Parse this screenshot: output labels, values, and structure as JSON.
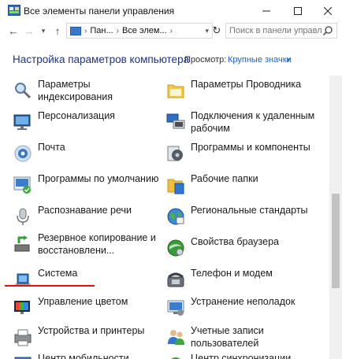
{
  "window": {
    "title": "Все элементы панели управления",
    "controls": [
      "minimize",
      "maximize",
      "close"
    ]
  },
  "nav": {
    "crumbs": [
      "Пан...",
      "Все элем..."
    ],
    "search_placeholder": "Поиск в панели управле..."
  },
  "header": {
    "heading": "Настройка параметров компьютера",
    "view_label": "Просмотр:",
    "view_value": "Крупные значки"
  },
  "items": {
    "left": [
      {
        "label": "Параметры индексирования",
        "icon": "indexing-icon"
      },
      {
        "label": "Персонализация",
        "icon": "personalization-icon"
      },
      {
        "label": "Почта",
        "icon": "mail-icon"
      },
      {
        "label": "Программы по умолчанию",
        "icon": "default-programs-icon"
      },
      {
        "label": "Распознавание речи",
        "icon": "microphone-icon"
      },
      {
        "label": "Резервное копирование и восстановлени...",
        "icon": "backup-icon"
      },
      {
        "label": "Система",
        "icon": "system-icon"
      },
      {
        "label": "Управление цветом",
        "icon": "color-management-icon"
      },
      {
        "label": "Устройства и принтеры",
        "icon": "printer-icon"
      },
      {
        "label": "Центр мобильности",
        "icon": "mobility-icon"
      }
    ],
    "right": [
      {
        "label": "Параметры Проводника",
        "icon": "folder-options-icon"
      },
      {
        "label": "Подключения к удаленным рабочим",
        "icon": "remote-desktop-icon"
      },
      {
        "label": "Программы и компоненты",
        "icon": "programs-icon"
      },
      {
        "label": "Рабочие папки",
        "icon": "work-folders-icon"
      },
      {
        "label": "Региональные стандарты",
        "icon": "region-icon"
      },
      {
        "label": "Свойства браузера",
        "icon": "internet-options-icon"
      },
      {
        "label": "Телефон и модем",
        "icon": "phone-modem-icon"
      },
      {
        "label": "Устранение неполадок",
        "icon": "troubleshooting-icon"
      },
      {
        "label": "Учетные записи пользователей",
        "icon": "user-accounts-icon"
      },
      {
        "label": "Центр синхронизации",
        "icon": "sync-center-icon"
      }
    ]
  },
  "colors": {
    "heading": "#1e3287",
    "link": "#1e64c8",
    "highlight_underline": "#e01010"
  }
}
